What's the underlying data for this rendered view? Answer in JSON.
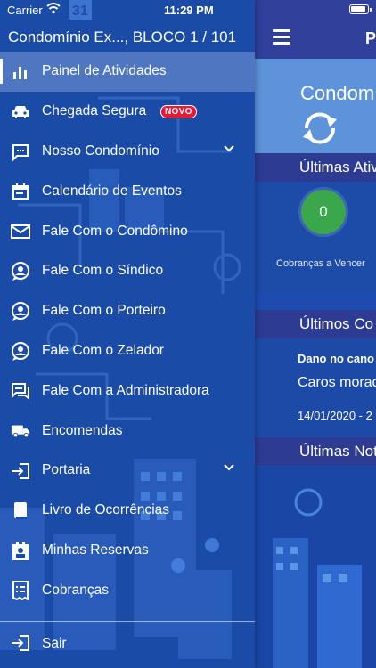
{
  "status_bar": {
    "carrier": "Carrier",
    "time": "11:29 PM"
  },
  "drawer": {
    "title": "Condomínio Ex..., BLOCO 1 / 101",
    "items": [
      {
        "label": "Painel de Atividades",
        "icon": "bar-chart-icon",
        "active": true
      },
      {
        "label": "Chegada Segura",
        "icon": "car-icon",
        "badge": "NOVO"
      },
      {
        "label": "Nosso Condomínio",
        "icon": "chat-icon",
        "expandable": true
      },
      {
        "label": "Calendário de Eventos",
        "icon": "calendar-icon"
      },
      {
        "label": "Fale Com o Condômino",
        "icon": "mail-icon"
      },
      {
        "label": "Fale Com o Síndico",
        "icon": "person-chat-icon"
      },
      {
        "label": "Fale Com o Porteiro",
        "icon": "person-chat-icon"
      },
      {
        "label": "Fale Com o Zelador",
        "icon": "person-chat-icon"
      },
      {
        "label": "Fale Com a Administradora",
        "icon": "forum-icon"
      },
      {
        "label": "Encomendas",
        "icon": "truck-icon"
      },
      {
        "label": "Portaria",
        "icon": "login-icon",
        "expandable": true
      },
      {
        "label": "Livro de Ocorrências",
        "icon": "book-icon"
      },
      {
        "label": "Minhas Reservas",
        "icon": "reservation-icon"
      },
      {
        "label": "Cobranças",
        "icon": "billing-icon"
      }
    ],
    "logout": {
      "label": "Sair",
      "icon": "logout-icon"
    }
  },
  "main": {
    "title": "P",
    "condo_name": "Condom",
    "sections": {
      "activities": "Últimas Ativ",
      "communications": "Últimos Co",
      "news": "Últimas Not"
    },
    "stats": {
      "count": "0",
      "label": "Cobranças a Vencer"
    },
    "notice": {
      "title": "Dano no cano",
      "text": "Caros morad",
      "date": "14/01/2020 - 2"
    }
  },
  "colors": {
    "drawer_bg": "#1a4ba6",
    "section_bar": "#2e3b92",
    "badge_green": "#3aa84a",
    "novo_red": "#e8183a"
  }
}
